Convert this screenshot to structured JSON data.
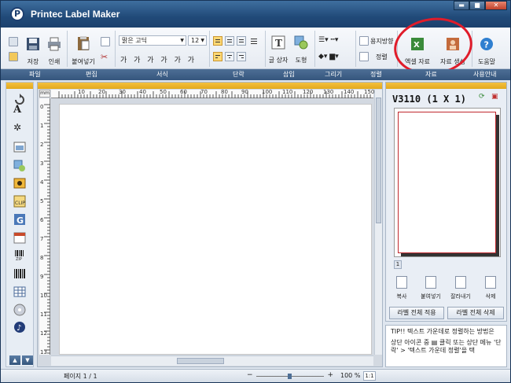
{
  "app": {
    "title": "Printec Label Maker",
    "logo_letter": "P"
  },
  "window_controls": {
    "minimize": "▬",
    "maximize": "■",
    "close": "✕"
  },
  "ribbon": {
    "file": {
      "save": "저장",
      "print": "인쇄"
    },
    "edit": {
      "paste": "붙여넣기"
    },
    "font": {
      "name": "맑은 고딕",
      "size": "12",
      "styles": "가 가 가 가 가 가"
    },
    "insert": {
      "textbox": "글 상자",
      "shape": "도형"
    },
    "arrange": {
      "paper_setup": "용지방향",
      "align": "정렬"
    },
    "data": {
      "excel": "엑셀 자료",
      "generate": "자료 생성"
    },
    "support": {
      "help": "도움말"
    }
  },
  "group_labels": [
    "파일",
    "편집",
    "서식",
    "단락",
    "삽입",
    "그리기",
    "정렬",
    "자료",
    "사용안내"
  ],
  "canvas": {
    "unit": "mm",
    "hruler_labels": [
      "10",
      "20",
      "30",
      "40",
      "50",
      "60",
      "70",
      "80",
      "90",
      "100",
      "110",
      "120",
      "130",
      "140",
      "150"
    ],
    "vruler_labels": [
      "0",
      "1",
      "2",
      "3",
      "4",
      "5",
      "6",
      "7",
      "8",
      "9",
      "10",
      "11",
      "12",
      "13"
    ]
  },
  "right_panel": {
    "model": "V3110 (1 X 1)",
    "page_num": "1",
    "buttons": [
      "복사",
      "붙여넣기",
      "잘라내기",
      "삭제"
    ],
    "apply_all": "라벨 전체 적용",
    "delete_all": "라벨 전체 삭제"
  },
  "tip": {
    "line1": "TIP!! 텍스트 가운데로 정렬하는 방법은",
    "line2": "상단 아이콘 중 ▤ 클릭 또는 상단 메뉴 '단락' > '텍스트 가운데 정렬'을 택"
  },
  "status": {
    "page": "페이지 1 / 1",
    "zoom_min": "−",
    "zoom_plus": "+",
    "zoom": "100 %",
    "ratio": "1:1"
  },
  "zoom_level_fraction": 0.5,
  "colors": {
    "titlebar": "#214a79",
    "group_bar": "#35567d",
    "accent_yellow": "#f4c040",
    "highlight_circle": "#e01c2a"
  }
}
